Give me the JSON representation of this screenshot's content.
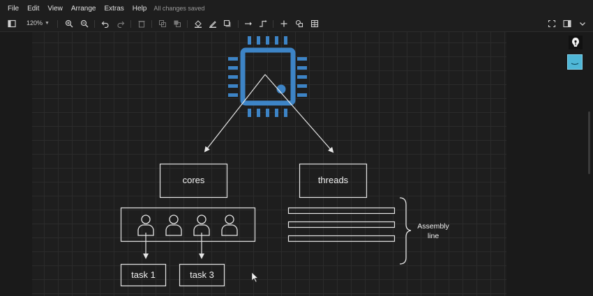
{
  "menu": {
    "file": "File",
    "edit": "Edit",
    "view": "View",
    "arrange": "Arrange",
    "extras": "Extras",
    "help": "Help",
    "status": "All changes saved"
  },
  "toolbar": {
    "zoom": "120%"
  },
  "diagram": {
    "cores_label": "cores",
    "threads_label": "threads",
    "task1_label": "task 1",
    "task3_label": "task 3",
    "assembly_label_line1": "Assembly",
    "assembly_label_line2": "line"
  },
  "colors": {
    "chip": "#3d84c6",
    "stroke": "#e6e6e6",
    "ext_icon": "#4fb7d7"
  },
  "icons": [
    "sidebar-toggle-icon",
    "zoom-in-icon",
    "zoom-out-icon",
    "undo-icon",
    "redo-icon",
    "delete-icon",
    "to-front-icon",
    "to-back-icon",
    "fill-color-icon",
    "line-color-icon",
    "shadow-icon",
    "connection-icon",
    "waypoints-icon",
    "insert-icon",
    "shapes-icon",
    "table-icon",
    "fullscreen-icon",
    "format-panel-icon",
    "collapse-icon"
  ]
}
